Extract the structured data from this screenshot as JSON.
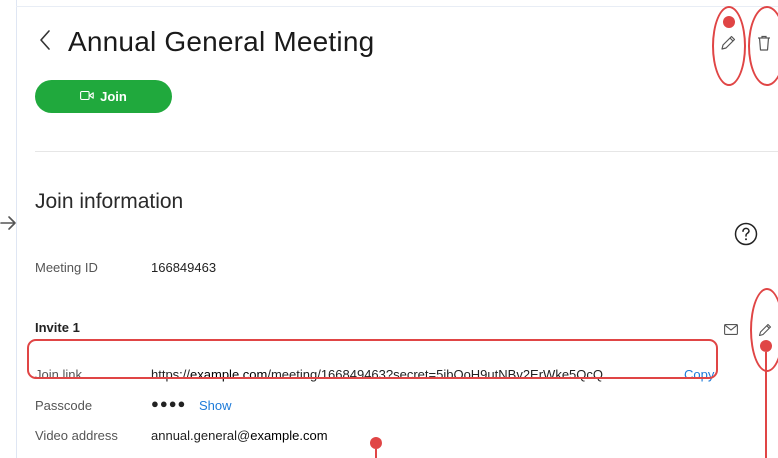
{
  "header": {
    "title": "Annual General Meeting",
    "join_label": "Join"
  },
  "join_info": {
    "heading": "Join information",
    "meeting_id_label": "Meeting ID",
    "meeting_id": "166849463",
    "invite_heading": "Invite 1",
    "join_link_label": "Join link",
    "join_link_prefix": "https://",
    "join_link_domain": "example.com",
    "join_link_suffix": "/meeting/166849463?secret=5ibOoH9utNBv2ErWke5QcQ",
    "copy_label": "Copy",
    "passcode_label": "Passcode",
    "passcode_masked": "●●●●",
    "show_label": "Show",
    "video_address_label": "Video address",
    "video_address_user": "annual.general@",
    "video_address_domain": "example.com"
  },
  "icons": {
    "back": "chevron-left-icon",
    "edit": "pencil-icon",
    "delete": "trash-icon",
    "camera": "video-camera-icon",
    "help": "question-circle-icon",
    "mail": "envelope-icon",
    "arrow": "arrow-right-icon"
  },
  "colors": {
    "join_button": "#20a93d",
    "link": "#1d7bd9",
    "annotation": "#e04545"
  }
}
